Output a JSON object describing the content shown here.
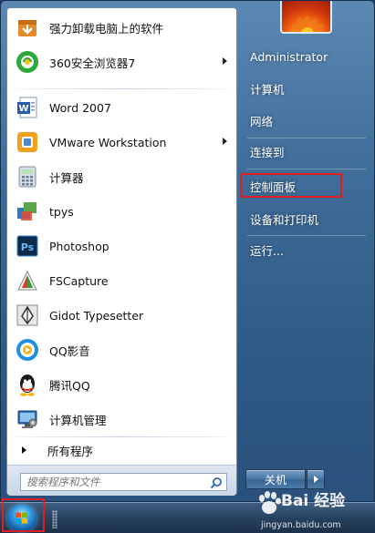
{
  "start_menu": {
    "programs": [
      {
        "label": "强力卸载电脑上的软件",
        "icon": "uninstall-icon",
        "has_submenu": false
      },
      {
        "label": "360安全浏览器7",
        "icon": "360-browser-icon",
        "has_submenu": true
      },
      {
        "label": "Word 2007",
        "icon": "word-icon",
        "has_submenu": false
      },
      {
        "label": "VMware Workstation",
        "icon": "vmware-icon",
        "has_submenu": true
      },
      {
        "label": "计算器",
        "icon": "calculator-icon",
        "has_submenu": false
      },
      {
        "label": "tpys",
        "icon": "tpys-icon",
        "has_submenu": false
      },
      {
        "label": "Photoshop",
        "icon": "photoshop-icon",
        "has_submenu": false
      },
      {
        "label": "FSCapture",
        "icon": "fscapture-icon",
        "has_submenu": false
      },
      {
        "label": "Gidot Typesetter",
        "icon": "gidot-icon",
        "has_submenu": false
      },
      {
        "label": "QQ影音",
        "icon": "qq-player-icon",
        "has_submenu": false
      },
      {
        "label": "腾讯QQ",
        "icon": "qq-icon",
        "has_submenu": false
      },
      {
        "label": "计算机管理",
        "icon": "computer-management-icon",
        "has_submenu": false
      }
    ],
    "all_programs_label": "所有程序",
    "search_placeholder": "搜索程序和文件",
    "right_items": [
      {
        "label": "Administrator"
      },
      {
        "label": "计算机"
      },
      {
        "label": "网络"
      },
      {
        "label": "连接到"
      },
      {
        "label": "控制面板",
        "highlighted": true
      },
      {
        "label": "设备和打印机"
      },
      {
        "label": "运行..."
      }
    ],
    "shutdown_label": "关机"
  },
  "watermark": {
    "main": "Bai 经验",
    "sub": "jingyan.baidu.com"
  },
  "colors": {
    "highlight_border": "#e02020",
    "menu_frame": "#3f6c98",
    "left_panel": "#ffffff"
  }
}
